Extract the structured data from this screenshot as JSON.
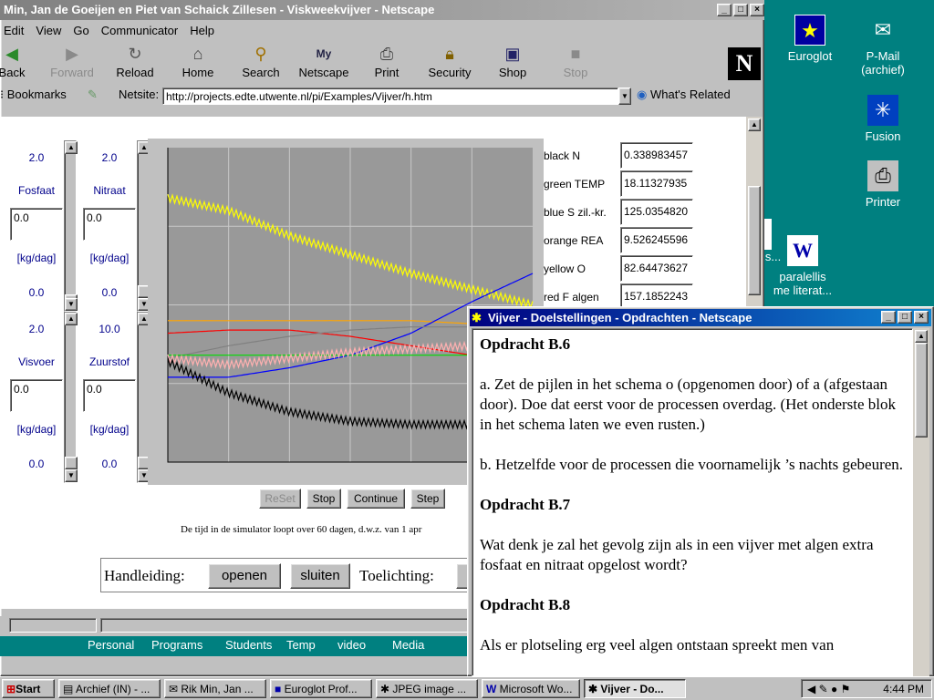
{
  "main_window": {
    "title": "Min, Jan de Goeijen en Piet van Schaick Zillesen - Viskweekvijver - Netscape",
    "menu": [
      "Edit",
      "View",
      "Go",
      "Communicator",
      "Help"
    ],
    "toolbar": [
      {
        "label": "Back",
        "icon": "back-arrow",
        "enabled": true
      },
      {
        "label": "Forward",
        "icon": "forward-arrow",
        "enabled": false
      },
      {
        "label": "Reload",
        "icon": "reload",
        "enabled": true
      },
      {
        "label": "Home",
        "icon": "home",
        "enabled": true
      },
      {
        "label": "Search",
        "icon": "search",
        "enabled": true
      },
      {
        "label": "Netscape",
        "icon": "netscape-my",
        "enabled": true
      },
      {
        "label": "Print",
        "icon": "printer",
        "enabled": true
      },
      {
        "label": "Security",
        "icon": "lock",
        "enabled": true
      },
      {
        "label": "Shop",
        "icon": "shop",
        "enabled": true
      },
      {
        "label": "Stop",
        "icon": "stop",
        "enabled": false
      }
    ],
    "location_bar": {
      "bookmarks_label": "Bookmarks",
      "netsite_label": "Netsite:",
      "url": "http://projects.edte.utwente.nl/pi/Examples/Vijver/h.htm",
      "whats_related": "What's Related"
    },
    "quick_links": [
      "Personal",
      "Programs",
      "Students",
      "Temp",
      "video",
      "Media"
    ]
  },
  "simulator": {
    "col1_upper": {
      "top_value": "2.0",
      "label": "Fosfaat",
      "input": "0.0",
      "unit": "[kg/dag]",
      "bottom_value": "0.0"
    },
    "col2_upper": {
      "top_value": "2.0",
      "label": "Nitraat",
      "input": "0.0",
      "unit": "[kg/dag]",
      "bottom_value": "0.0"
    },
    "col1_lower": {
      "top_value": "2.0",
      "label": "Visvoer",
      "input": "0.0",
      "unit": "[kg/dag]",
      "bottom_value": "0.0"
    },
    "col2_lower": {
      "top_value": "10.0",
      "label": "Zuurstof",
      "input": "0.0",
      "unit": "[kg/dag]",
      "bottom_value": "0.0"
    },
    "outputs": [
      {
        "label": "black N",
        "value": "0.338983457"
      },
      {
        "label": "green TEMP",
        "value": "18.11327935"
      },
      {
        "label": "blue S zil.-kr.",
        "value": "125.0354820"
      },
      {
        "label": "orange REA",
        "value": "9.526245596"
      },
      {
        "label": "yellow O",
        "value": "82.64473627"
      },
      {
        "label": "red F algen",
        "value": "157.1852243"
      }
    ],
    "buttons": {
      "reset": "ReSet",
      "stop": "Stop",
      "continue": "Continue",
      "step": "Step"
    },
    "note": "De tijd in de simulator loopt over 60 dagen, d.w.z. van 1 apr",
    "manual_label": "Handleiding:",
    "open_button": "openen",
    "close_button": "sluiten",
    "explanation_label": "Toelichting:"
  },
  "chart_data": {
    "type": "line",
    "title": "",
    "xlabel": "",
    "ylabel": "",
    "grid": true,
    "background": "#999999",
    "x": [
      0,
      1,
      2,
      3,
      4,
      5,
      6
    ],
    "series": [
      {
        "color": "#ffff00",
        "values": [
          0.84,
          0.8,
          0.72,
          0.66,
          0.6,
          0.55,
          0.5
        ],
        "oscillating": true
      },
      {
        "color": "#ffa500",
        "values": [
          0.45,
          0.45,
          0.45,
          0.45,
          0.45,
          0.44,
          0.44
        ]
      },
      {
        "color": "#ff0000",
        "values": [
          0.41,
          0.42,
          0.42,
          0.4,
          0.37,
          0.34,
          0.32
        ]
      },
      {
        "color": "#0000ff",
        "values": [
          0.27,
          0.27,
          0.3,
          0.34,
          0.41,
          0.51,
          0.6
        ]
      },
      {
        "color": "#808080",
        "values": [
          0.33,
          0.37,
          0.4,
          0.42,
          0.43,
          0.43,
          0.43
        ]
      },
      {
        "color": "#00dd00",
        "values": [
          0.34,
          0.34,
          0.34,
          0.34,
          0.34,
          0.34,
          0.34
        ]
      },
      {
        "color": "#ffb0b0",
        "values": [
          0.33,
          0.31,
          0.33,
          0.35,
          0.36,
          0.37,
          0.37
        ],
        "oscillating": true
      },
      {
        "color": "#000000",
        "values": [
          0.32,
          0.22,
          0.16,
          0.13,
          0.12,
          0.12,
          0.12
        ],
        "oscillating": true
      }
    ]
  },
  "desktop_icons": [
    {
      "label": "Euroglot",
      "icon": "euroglot-icon"
    },
    {
      "label": "P-Mail (archief)",
      "icon": "pmail-icon"
    },
    {
      "label": "Fusion",
      "icon": "fusion-icon"
    },
    {
      "label": "Printer",
      "icon": "printer-icon"
    },
    {
      "label": "paralellis me literat...",
      "icon": "word-document-icon"
    },
    {
      "label": "is...",
      "icon": "document-icon"
    }
  ],
  "popup_window": {
    "title": "Vijver - Doelstellingen - Opdrachten - Netscape",
    "content": [
      {
        "type": "heading",
        "text": "Opdracht B.6"
      },
      {
        "type": "para",
        "text": "a. Zet de pijlen in het schema o (opgenomen door) of a (afgestaan door). Doe dat eerst voor de processen overdag. (Het onderste blok in het schema laten we even rusten.)"
      },
      {
        "type": "para",
        "text": "b. Hetzelfde voor de processen die voornamelijk ’s nachts gebeuren."
      },
      {
        "type": "heading",
        "text": "Opdracht B.7"
      },
      {
        "type": "para",
        "text": "Wat denk je zal het gevolg zijn als in een vijver met algen extra fosfaat en nitraat opgelost wordt?"
      },
      {
        "type": "heading",
        "text": "Opdracht B.8"
      },
      {
        "type": "para",
        "text": "Als er plotseling erg veel algen ontstaan spreekt men van"
      }
    ]
  },
  "taskbar": {
    "start": "Start",
    "tasks": [
      {
        "label": "Archief (IN) - ...",
        "active": false
      },
      {
        "label": "Rik Min, Jan ...",
        "active": false
      },
      {
        "label": "Euroglot Prof...",
        "active": false
      },
      {
        "label": "JPEG image ...",
        "active": false
      },
      {
        "label": "Microsoft Wo...",
        "active": false
      },
      {
        "label": "Vijver - Do...",
        "active": true
      }
    ],
    "clock": "4:44 PM"
  }
}
